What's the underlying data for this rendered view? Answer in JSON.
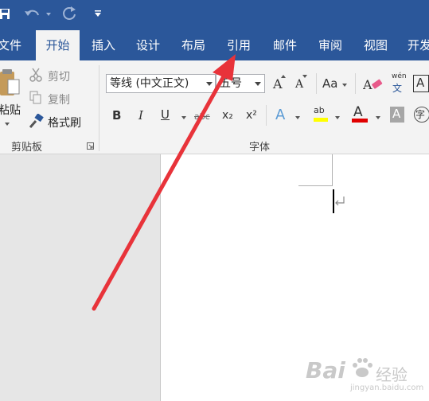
{
  "tabs": [
    "文件",
    "开始",
    "插入",
    "设计",
    "布局",
    "引用",
    "邮件",
    "审阅",
    "视图",
    "开发"
  ],
  "clipboard": {
    "paste_label": "粘贴",
    "cut_label": "剪切",
    "copy_label": "复制",
    "format_painter_label": "格式刷",
    "group_label": "剪贴板"
  },
  "font": {
    "font_name": "等线 (中文正文)",
    "font_size": "五号",
    "grow_label": "A",
    "shrink_label": "A",
    "change_case_label": "Aa",
    "phonetic_small": "wén",
    "phonetic_char": "文",
    "border_char_label": "A",
    "bold_label": "B",
    "italic_label": "I",
    "underline_label": "U",
    "strike_label": "abc",
    "subscript_label": "x₂",
    "superscript_label": "x²",
    "text_effect_label": "A",
    "highlight_label": "ab",
    "font_color_label": "A",
    "shading_label": "A",
    "enclose_char_label": "字",
    "group_label": "字体"
  },
  "watermark": {
    "brand": "Bai",
    "brand_cn": "经验",
    "url": "jingyan.baidu.com"
  },
  "colors": {
    "accent": "#2b579a",
    "arrow": "#e8333a",
    "highlight": "#ffff00",
    "font_red": "#e00000"
  }
}
